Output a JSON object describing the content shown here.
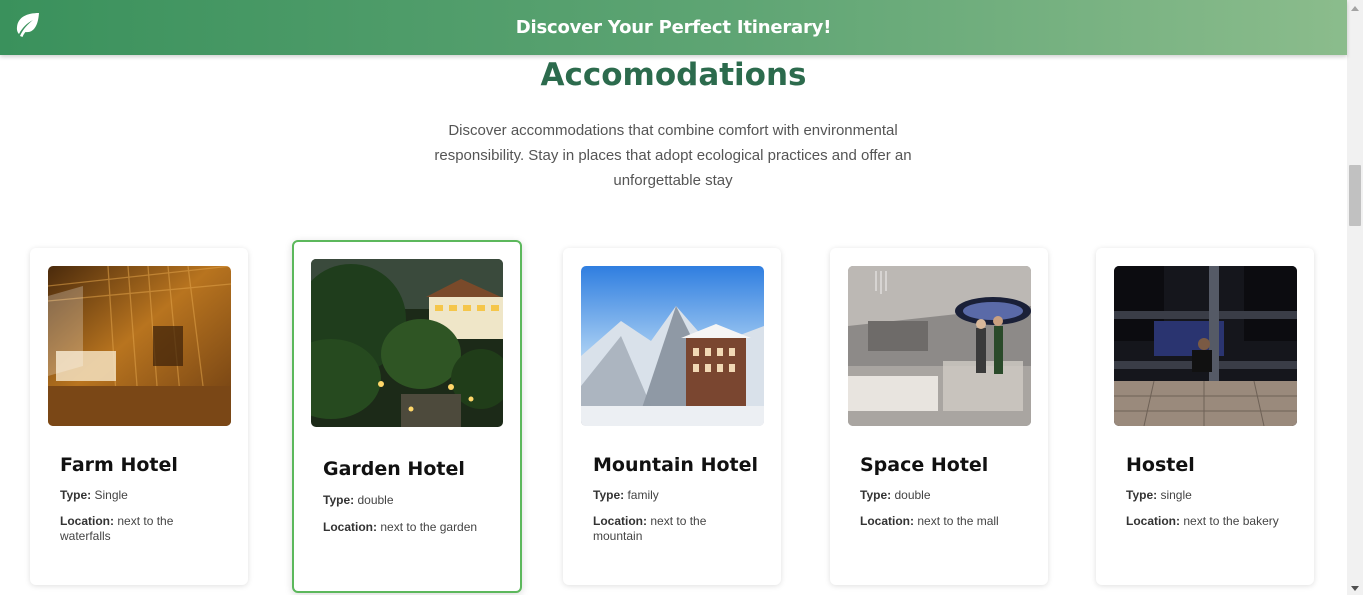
{
  "header": {
    "title": "Discover Your Perfect Itinerary!",
    "logo_icon": "leaf-icon"
  },
  "section": {
    "heading": "Accomodations",
    "intro": "Discover accommodations that combine comfort with environmental responsibility. Stay in places that adopt ecological practices and offer an unforgettable stay"
  },
  "labels": {
    "type": "Type:",
    "location": "Location:"
  },
  "cards": [
    {
      "name": "Farm Hotel",
      "type": "Single",
      "location": "next to the waterfalls",
      "image": "bamboo-room-photo"
    },
    {
      "name": "Garden Hotel",
      "type": "double",
      "location": "next to the garden",
      "image": "garden-resort-photo",
      "selected": true
    },
    {
      "name": "Mountain Hotel",
      "type": "family",
      "location": "next to the mountain",
      "image": "snowy-mountain-hotel-photo"
    },
    {
      "name": "Space Hotel",
      "type": "double",
      "location": "next to the mall",
      "image": "space-room-photo"
    },
    {
      "name": "Hostel",
      "type": "single",
      "location": "next to the bakery",
      "image": "bunk-bed-hostel-photo"
    }
  ],
  "colors": {
    "header_gradient_start": "#3a915c",
    "header_gradient_end": "#8bbc8c",
    "heading": "#2c6b4d",
    "selected_border": "#5cb85c"
  }
}
